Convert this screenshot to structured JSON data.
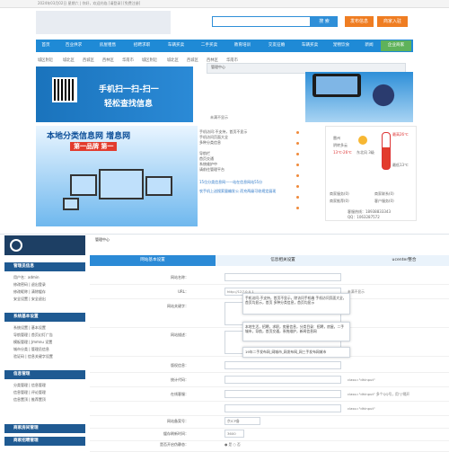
{
  "topbar": {
    "text": "2024年03月02日 星期六 | 你好，欢迎光临 [请登录] [免费注册]"
  },
  "header": {
    "search_btn": "搜 索",
    "publish_btn": "发布信息",
    "join_btn": "商家入驻"
  },
  "nav": {
    "items": [
      "首页",
      "百业供求",
      "房屋租售",
      "招聘求职",
      "车辆买卖",
      "二手买卖",
      "教育培训",
      "交友征婚",
      "车辆买卖",
      "宠物饮食"
    ],
    "news": "新闻",
    "biz": "企业商家"
  },
  "areas": [
    "城区附近",
    "城北区",
    "西城区",
    "西林区",
    "华南市",
    "城区附近",
    "城北区",
    "西城区",
    "西林区",
    "华南市"
  ],
  "banner1": {
    "line1": "手机扫一扫-扫一",
    "line2": "轻松查找信息"
  },
  "admin_top": {
    "title": "管理中心"
  },
  "popup_top": {
    "text": "未满不显示"
  },
  "banner2": {
    "line1": "本地分类信息网 增息网",
    "line2": "第一品牌 第一"
  },
  "info": {
    "lines": [
      "手机访问:不支持，首页不显示",
      "手机访问页面大全",
      "多种分类信息",
      "导航栏",
      "首页交通",
      "系统维护中",
      "请前往管理平台"
    ],
    "blue": [
      "15位分类信息网——站在信息网站55分",
      "农手机上送搜索量编发公 而充两级可收规定展现"
    ]
  },
  "weather": {
    "city": "雷州",
    "cond": "阴转多云",
    "temp": "13℃-26℃",
    "wind": "东北风 3级",
    "hi": "最高26℃",
    "lo": "最低13℃"
  },
  "contact": {
    "l1": "商家服务(0)",
    "l2": "商家联系(0)",
    "l3": "商家推荐(0)",
    "l4": "客户服务(0)",
    "phone": "客服热线：18938833343",
    "qq": "QQ：1063287572"
  },
  "sidebar": {
    "sections": [
      "管理员信息",
      "系统基本设置",
      "信息管理",
      "商家房间管理",
      "商家招聘管理"
    ],
    "items1": [
      "用户名：admin",
      "修改密码 | 退出登录",
      "修改昵称 | 清除缓存",
      "安全设置 | 安全退出"
    ],
    "items2": [
      "系统设置 | 基本设置",
      "导航管理 | 首页幻灯广告",
      "模板管理 | Jmmnu 设置",
      "城市分类 | 管理员信息",
      "验证码 | 信息关键字设置"
    ],
    "items3": [
      "分类管理 | 信息管理",
      "信息管理 | 评论管理",
      "信息置顶 | 推荐置顶"
    ]
  },
  "main": {
    "crumb": "管理中心",
    "tabs": [
      "网站基本设置",
      "信息相关设置",
      "ucenter整合"
    ],
    "rows": [
      {
        "label": "网站名称：",
        "value": "",
        "note": ""
      },
      {
        "label": "URL：",
        "value": "http://127.0.0.1",
        "note": "未满不显示"
      },
      {
        "label": "网站关键字：",
        "value": "",
        "note": ""
      },
      {
        "label": "网站描述：",
        "value": "",
        "note": ""
      },
      {
        "label": "版权信息：",
        "value": "",
        "note": ""
      },
      {
        "label": "统计代码：",
        "value": "",
        "note": "class=\"dhinput\""
      },
      {
        "label": "在线客服：",
        "value": "",
        "note": "class=\"dhinput\" 多个QQ号，用\"|\"隔开"
      },
      {
        "label": "",
        "value": "",
        "note": "class=\"dhinput\""
      },
      {
        "label": "",
        "value": "",
        "note": "class=\"dhinput\""
      },
      {
        "label": "网站备案号：",
        "value": "京ICP备",
        "note": ""
      },
      {
        "label": "缓存刷新时间：",
        "value": "3600",
        "note": ""
      },
      {
        "label": "是否开启伪静态：",
        "value": "● 是  ○ 否",
        "note": ""
      }
    ],
    "pop1": "手机访问:不支持，首页不显示，除访问手机端\n手机访问页面大全，首页均显示，首页\n多种分类信息，首页均显示",
    "pop2": "19年二手发布网_网城市_网发布网_网三手发布网城市\n",
    "pop3": "本地生活，招聘，求职，房屋信息，分类目录：招聘，房屋，二手\n城市，导航，首页交通，系统维护，新闻信息网"
  }
}
